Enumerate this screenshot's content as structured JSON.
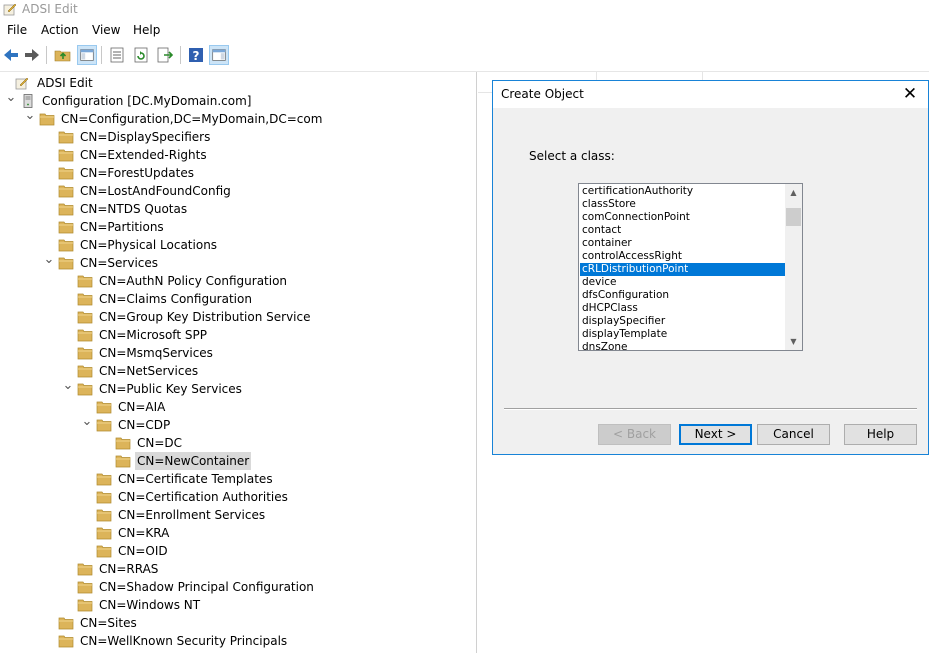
{
  "window": {
    "title": "ADSI Edit"
  },
  "menu": [
    "File",
    "Action",
    "View",
    "Help"
  ],
  "toolbar": [
    "back-arrow-icon",
    "forward-arrow-icon",
    "up-folder-icon",
    "show-hide-tree-icon",
    "properties-icon",
    "refresh-icon",
    "export-list-icon",
    "help-icon",
    "show-action-pane-icon"
  ],
  "tree": [
    {
      "label": "ADSI Edit",
      "level": 0,
      "expander": "",
      "icon": "adsi-edit-icon"
    },
    {
      "label": "Configuration [DC.MyDomain.com]",
      "level": 0,
      "expander": "expanded",
      "icon": "server-icon"
    },
    {
      "label": "CN=Configuration,DC=MyDomain,DC=com",
      "level": 1,
      "expander": "expanded",
      "icon": "folder-icon"
    },
    {
      "label": "CN=DisplaySpecifiers",
      "level": 2,
      "expander": "",
      "icon": "folder-icon"
    },
    {
      "label": "CN=Extended-Rights",
      "level": 2,
      "expander": "",
      "icon": "folder-icon"
    },
    {
      "label": "CN=ForestUpdates",
      "level": 2,
      "expander": "",
      "icon": "folder-icon"
    },
    {
      "label": "CN=LostAndFoundConfig",
      "level": 2,
      "expander": "",
      "icon": "folder-icon"
    },
    {
      "label": "CN=NTDS Quotas",
      "level": 2,
      "expander": "",
      "icon": "folder-icon"
    },
    {
      "label": "CN=Partitions",
      "level": 2,
      "expander": "",
      "icon": "folder-icon"
    },
    {
      "label": "CN=Physical Locations",
      "level": 2,
      "expander": "",
      "icon": "folder-icon"
    },
    {
      "label": "CN=Services",
      "level": 2,
      "expander": "expanded",
      "icon": "folder-icon"
    },
    {
      "label": "CN=AuthN Policy Configuration",
      "level": 3,
      "expander": "",
      "icon": "folder-icon"
    },
    {
      "label": "CN=Claims Configuration",
      "level": 3,
      "expander": "",
      "icon": "folder-icon"
    },
    {
      "label": "CN=Group Key Distribution Service",
      "level": 3,
      "expander": "",
      "icon": "folder-icon"
    },
    {
      "label": "CN=Microsoft SPP",
      "level": 3,
      "expander": "",
      "icon": "folder-icon"
    },
    {
      "label": "CN=MsmqServices",
      "level": 3,
      "expander": "",
      "icon": "folder-icon"
    },
    {
      "label": "CN=NetServices",
      "level": 3,
      "expander": "",
      "icon": "folder-icon"
    },
    {
      "label": "CN=Public Key Services",
      "level": 3,
      "expander": "expanded",
      "icon": "folder-icon"
    },
    {
      "label": "CN=AIA",
      "level": 4,
      "expander": "",
      "icon": "folder-icon"
    },
    {
      "label": "CN=CDP",
      "level": 4,
      "expander": "expanded",
      "icon": "folder-icon"
    },
    {
      "label": "CN=DC",
      "level": 5,
      "expander": "",
      "icon": "folder-icon"
    },
    {
      "label": "CN=NewContainer",
      "level": 5,
      "expander": "",
      "icon": "folder-icon",
      "selected": true
    },
    {
      "label": "CN=Certificate Templates",
      "level": 4,
      "expander": "",
      "icon": "folder-icon"
    },
    {
      "label": "CN=Certification Authorities",
      "level": 4,
      "expander": "",
      "icon": "folder-icon"
    },
    {
      "label": "CN=Enrollment Services",
      "level": 4,
      "expander": "",
      "icon": "folder-icon"
    },
    {
      "label": "CN=KRA",
      "level": 4,
      "expander": "",
      "icon": "folder-icon"
    },
    {
      "label": "CN=OID",
      "level": 4,
      "expander": "",
      "icon": "folder-icon"
    },
    {
      "label": "CN=RRAS",
      "level": 3,
      "expander": "",
      "icon": "folder-icon"
    },
    {
      "label": "CN=Shadow Principal Configuration",
      "level": 3,
      "expander": "",
      "icon": "folder-icon"
    },
    {
      "label": "CN=Windows NT",
      "level": 3,
      "expander": "",
      "icon": "folder-icon"
    },
    {
      "label": "CN=Sites",
      "level": 2,
      "expander": "",
      "icon": "folder-icon"
    },
    {
      "label": "CN=WellKnown Security Principals",
      "level": 2,
      "expander": "",
      "icon": "folder-icon"
    }
  ],
  "dialog": {
    "title": "Create Object",
    "select_label": "Select a class:",
    "classes": [
      "certificationAuthority",
      "classStore",
      "comConnectionPoint",
      "contact",
      "container",
      "controlAccessRight",
      "cRLDistributionPoint",
      "device",
      "dfsConfiguration",
      "dHCPClass",
      "displaySpecifier",
      "displayTemplate",
      "dnsZone"
    ],
    "selected_class": "cRLDistributionPoint",
    "buttons": {
      "back": "< Back",
      "next": "Next >",
      "cancel": "Cancel",
      "help": "Help"
    }
  },
  "colors": {
    "selection": "#0078d7",
    "folder": "#dcb45a",
    "dialog_border": "#1883d7"
  }
}
